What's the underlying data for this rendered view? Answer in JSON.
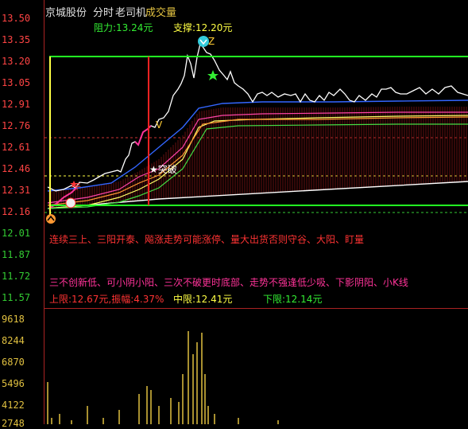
{
  "header": {
    "stock_name": "京城股份",
    "mode": "分时",
    "indicator": "老司机",
    "volume_tab": "成交量",
    "resistance": "阻力:13.24元",
    "support": "支撑:12.20元"
  },
  "price_axis": [
    "13.50",
    "13.35",
    "13.20",
    "13.05",
    "12.91",
    "12.76",
    "12.61",
    "12.46",
    "12.31",
    "12.16",
    "12.01",
    "11.87",
    "11.72",
    "11.57"
  ],
  "volume_axis": [
    "9618",
    "8244",
    "6870",
    "5496",
    "4122",
    "2748"
  ],
  "markers": {
    "z_label": "Z",
    "v_label": "V",
    "breakout_label": "★突破",
    "plus_label": "+",
    "small_label": "平"
  },
  "notes": {
    "line1": "连续三上、三阳开泰、飚涨走势可能涨停、量大出货否则守谷、大阳、盯量",
    "line2": "三不创新低、可小阴小阳、三次不破更时底部、走势不强逢低少吸、下影阴阳、小K线"
  },
  "summary": {
    "upper": "上限:12.67元,振幅:4.37%",
    "middle": "中限:12.41元",
    "lower": "下限:12.14元"
  },
  "colors": {
    "up": "#ff3333",
    "down": "#33cc33",
    "yellow": "#ffff44",
    "bright_green": "#22ff22",
    "pink": "#ff3399",
    "blue": "#3366ff"
  }
}
